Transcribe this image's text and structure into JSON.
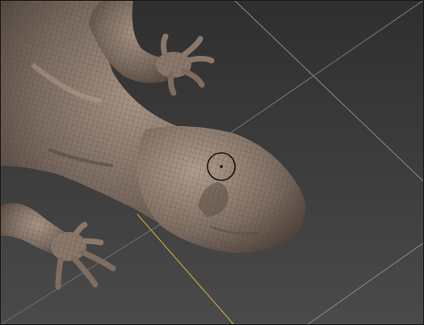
{
  "app": {
    "viewport_label": ""
  },
  "scene": {
    "model": "lizard-sculpt",
    "material_color": "#7a6a5f",
    "shadow_color": "#4a3f38",
    "highlight_color": "#a89586",
    "grid_line_color": "#8a8a8a",
    "axis_color": "#c8a43a"
  },
  "brush": {
    "icon": "brush-cursor-icon",
    "state": "hover"
  }
}
